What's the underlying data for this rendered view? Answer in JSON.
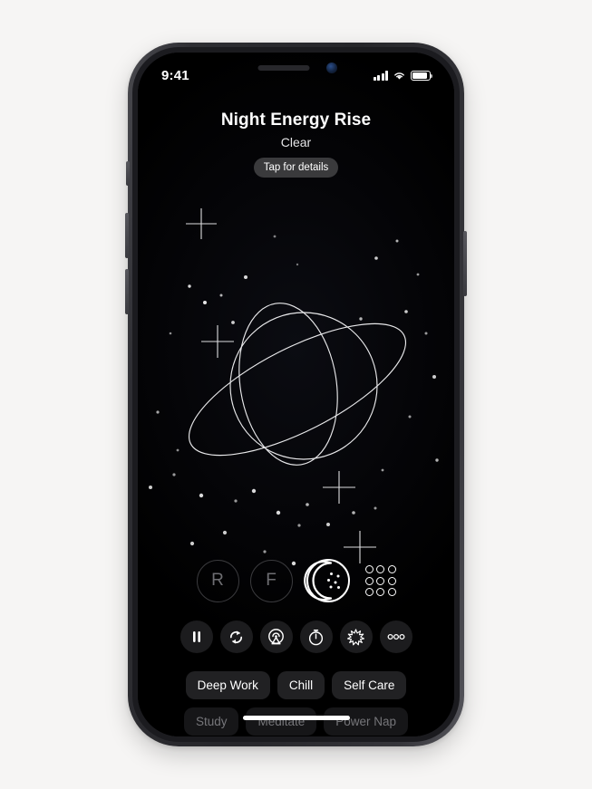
{
  "device": {
    "name": "iphone-mockup",
    "frame_color": "#2e2e33",
    "screen_background": "#000000"
  },
  "status_bar": {
    "time": "9:41",
    "cellular_icon": "cellular-signal-icon",
    "wifi_icon": "wifi-icon",
    "battery_icon": "battery-icon"
  },
  "header": {
    "title": "Night Energy Rise",
    "subtitle": "Clear",
    "details_button": "Tap for details"
  },
  "illustration": {
    "name": "saturn-planet-starfield",
    "description": "Line-art ringed planet with orbit ellipse over a star field",
    "stroke_color": "#e8e8ea"
  },
  "badges": {
    "items": [
      {
        "label": "R",
        "name": "badge-r",
        "style": "dim-outline-circle"
      },
      {
        "label": "F",
        "name": "badge-f",
        "style": "dim-outline-circle"
      }
    ],
    "moon_icon": "moon-stars-icon",
    "grid_icon": "dot-grid-icon"
  },
  "toolbar": {
    "buttons": [
      {
        "name": "pause-button",
        "icon": "pause-icon"
      },
      {
        "name": "loop-button",
        "icon": "refresh-loop-icon"
      },
      {
        "name": "airplay-button",
        "icon": "airplay-icon"
      },
      {
        "name": "timer-button",
        "icon": "stopwatch-icon"
      },
      {
        "name": "effects-button",
        "icon": "sparkle-burst-icon"
      },
      {
        "name": "more-button",
        "icon": "more-dots-icon"
      }
    ]
  },
  "chips": {
    "row_primary": [
      "Deep Work",
      "Chill",
      "Self Care"
    ],
    "row_secondary": [
      "Study",
      "Meditate",
      "Power Nap"
    ]
  },
  "colors": {
    "page_background": "#f6f5f4",
    "chip_background": "#212123",
    "chip_text": "#ffffff",
    "pill_background": "#3a3a3c",
    "tool_background": "#1c1c1e",
    "accent_stroke": "#ffffff"
  }
}
